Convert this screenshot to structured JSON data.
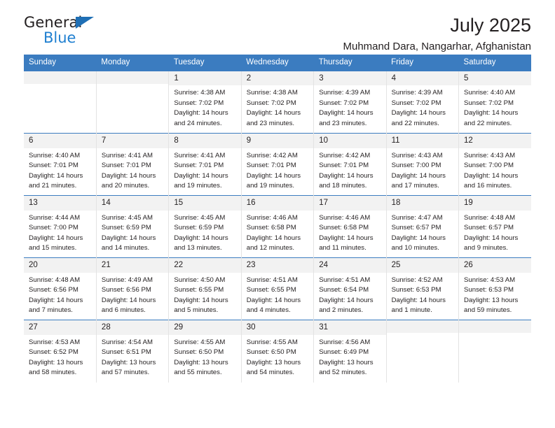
{
  "brand": {
    "name_top": "General",
    "name_bottom": "Blue",
    "triangle_color": "#1f6fb5",
    "blue_color": "#1f7fd0"
  },
  "header": {
    "month_title": "July 2025",
    "location": "Muhmand Dara, Nangarhar, Afghanistan"
  },
  "theme": {
    "header_blue": "#3b7cc0",
    "daynum_gray": "#f2f2f2",
    "text": "#231f20",
    "cell_divider": "#e3e3e3"
  },
  "weekdays": [
    "Sunday",
    "Monday",
    "Tuesday",
    "Wednesday",
    "Thursday",
    "Friday",
    "Saturday"
  ],
  "weeks": [
    [
      {
        "day": "",
        "empty": true
      },
      {
        "day": "",
        "empty": true
      },
      {
        "day": "1",
        "sunrise": "Sunrise: 4:38 AM",
        "sunset": "Sunset: 7:02 PM",
        "daylight": "Daylight: 14 hours and 24 minutes."
      },
      {
        "day": "2",
        "sunrise": "Sunrise: 4:38 AM",
        "sunset": "Sunset: 7:02 PM",
        "daylight": "Daylight: 14 hours and 23 minutes."
      },
      {
        "day": "3",
        "sunrise": "Sunrise: 4:39 AM",
        "sunset": "Sunset: 7:02 PM",
        "daylight": "Daylight: 14 hours and 23 minutes."
      },
      {
        "day": "4",
        "sunrise": "Sunrise: 4:39 AM",
        "sunset": "Sunset: 7:02 PM",
        "daylight": "Daylight: 14 hours and 22 minutes."
      },
      {
        "day": "5",
        "sunrise": "Sunrise: 4:40 AM",
        "sunset": "Sunset: 7:02 PM",
        "daylight": "Daylight: 14 hours and 22 minutes."
      }
    ],
    [
      {
        "day": "6",
        "sunrise": "Sunrise: 4:40 AM",
        "sunset": "Sunset: 7:01 PM",
        "daylight": "Daylight: 14 hours and 21 minutes."
      },
      {
        "day": "7",
        "sunrise": "Sunrise: 4:41 AM",
        "sunset": "Sunset: 7:01 PM",
        "daylight": "Daylight: 14 hours and 20 minutes."
      },
      {
        "day": "8",
        "sunrise": "Sunrise: 4:41 AM",
        "sunset": "Sunset: 7:01 PM",
        "daylight": "Daylight: 14 hours and 19 minutes."
      },
      {
        "day": "9",
        "sunrise": "Sunrise: 4:42 AM",
        "sunset": "Sunset: 7:01 PM",
        "daylight": "Daylight: 14 hours and 19 minutes."
      },
      {
        "day": "10",
        "sunrise": "Sunrise: 4:42 AM",
        "sunset": "Sunset: 7:01 PM",
        "daylight": "Daylight: 14 hours and 18 minutes."
      },
      {
        "day": "11",
        "sunrise": "Sunrise: 4:43 AM",
        "sunset": "Sunset: 7:00 PM",
        "daylight": "Daylight: 14 hours and 17 minutes."
      },
      {
        "day": "12",
        "sunrise": "Sunrise: 4:43 AM",
        "sunset": "Sunset: 7:00 PM",
        "daylight": "Daylight: 14 hours and 16 minutes."
      }
    ],
    [
      {
        "day": "13",
        "sunrise": "Sunrise: 4:44 AM",
        "sunset": "Sunset: 7:00 PM",
        "daylight": "Daylight: 14 hours and 15 minutes."
      },
      {
        "day": "14",
        "sunrise": "Sunrise: 4:45 AM",
        "sunset": "Sunset: 6:59 PM",
        "daylight": "Daylight: 14 hours and 14 minutes."
      },
      {
        "day": "15",
        "sunrise": "Sunrise: 4:45 AM",
        "sunset": "Sunset: 6:59 PM",
        "daylight": "Daylight: 14 hours and 13 minutes."
      },
      {
        "day": "16",
        "sunrise": "Sunrise: 4:46 AM",
        "sunset": "Sunset: 6:58 PM",
        "daylight": "Daylight: 14 hours and 12 minutes."
      },
      {
        "day": "17",
        "sunrise": "Sunrise: 4:46 AM",
        "sunset": "Sunset: 6:58 PM",
        "daylight": "Daylight: 14 hours and 11 minutes."
      },
      {
        "day": "18",
        "sunrise": "Sunrise: 4:47 AM",
        "sunset": "Sunset: 6:57 PM",
        "daylight": "Daylight: 14 hours and 10 minutes."
      },
      {
        "day": "19",
        "sunrise": "Sunrise: 4:48 AM",
        "sunset": "Sunset: 6:57 PM",
        "daylight": "Daylight: 14 hours and 9 minutes."
      }
    ],
    [
      {
        "day": "20",
        "sunrise": "Sunrise: 4:48 AM",
        "sunset": "Sunset: 6:56 PM",
        "daylight": "Daylight: 14 hours and 7 minutes."
      },
      {
        "day": "21",
        "sunrise": "Sunrise: 4:49 AM",
        "sunset": "Sunset: 6:56 PM",
        "daylight": "Daylight: 14 hours and 6 minutes."
      },
      {
        "day": "22",
        "sunrise": "Sunrise: 4:50 AM",
        "sunset": "Sunset: 6:55 PM",
        "daylight": "Daylight: 14 hours and 5 minutes."
      },
      {
        "day": "23",
        "sunrise": "Sunrise: 4:51 AM",
        "sunset": "Sunset: 6:55 PM",
        "daylight": "Daylight: 14 hours and 4 minutes."
      },
      {
        "day": "24",
        "sunrise": "Sunrise: 4:51 AM",
        "sunset": "Sunset: 6:54 PM",
        "daylight": "Daylight: 14 hours and 2 minutes."
      },
      {
        "day": "25",
        "sunrise": "Sunrise: 4:52 AM",
        "sunset": "Sunset: 6:53 PM",
        "daylight": "Daylight: 14 hours and 1 minute."
      },
      {
        "day": "26",
        "sunrise": "Sunrise: 4:53 AM",
        "sunset": "Sunset: 6:53 PM",
        "daylight": "Daylight: 13 hours and 59 minutes."
      }
    ],
    [
      {
        "day": "27",
        "sunrise": "Sunrise: 4:53 AM",
        "sunset": "Sunset: 6:52 PM",
        "daylight": "Daylight: 13 hours and 58 minutes."
      },
      {
        "day": "28",
        "sunrise": "Sunrise: 4:54 AM",
        "sunset": "Sunset: 6:51 PM",
        "daylight": "Daylight: 13 hours and 57 minutes."
      },
      {
        "day": "29",
        "sunrise": "Sunrise: 4:55 AM",
        "sunset": "Sunset: 6:50 PM",
        "daylight": "Daylight: 13 hours and 55 minutes."
      },
      {
        "day": "30",
        "sunrise": "Sunrise: 4:55 AM",
        "sunset": "Sunset: 6:50 PM",
        "daylight": "Daylight: 13 hours and 54 minutes."
      },
      {
        "day": "31",
        "sunrise": "Sunrise: 4:56 AM",
        "sunset": "Sunset: 6:49 PM",
        "daylight": "Daylight: 13 hours and 52 minutes."
      },
      {
        "day": "",
        "empty": true
      },
      {
        "day": "",
        "empty": true
      }
    ]
  ]
}
